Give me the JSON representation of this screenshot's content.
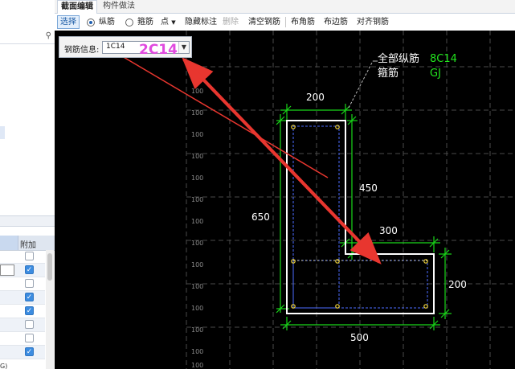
{
  "tabs": {
    "section_edit": "截面编辑",
    "member_method": "构件做法"
  },
  "toolbar": {
    "select": "选择",
    "longitudinal": "纵筋",
    "stirrup": "箍筋",
    "point": "点",
    "hide_annotation": "隐藏标注",
    "delete": "删除",
    "clear_rebar": "清空钢筋",
    "corner_rebar": "布角筋",
    "edge_rebar": "布边筋",
    "align_rebar": "对齐钢筋"
  },
  "rebar_info": {
    "label": "钢筋信息:",
    "value": "1C14"
  },
  "annotation": {
    "text": "2C14",
    "color": "#e04adf"
  },
  "legend": {
    "all_longitudinal_label": "全部纵筋",
    "all_longitudinal_value": "8C14",
    "stirrup_label": "箍筋",
    "stirrup_value": "GJ",
    "text_color": "#ffffff",
    "value_color": "#22e61e"
  },
  "dimensions": {
    "top_width": "200",
    "right_height": "450",
    "total_height": "650",
    "step_width": "300",
    "bottom_height": "200",
    "bottom_width": "500"
  },
  "grid_labels": [
    "100",
    "100",
    "100",
    "100",
    "100",
    "100",
    "100",
    "100",
    "100",
    "100",
    "100",
    "100",
    "100",
    "100",
    "100"
  ],
  "left_grid": {
    "header": "附加",
    "rows": [
      false,
      true,
      false,
      true,
      true,
      false,
      false,
      true
    ],
    "footer": "G)"
  },
  "colors": {
    "dimension": "#19d719",
    "section_outline": "#ffffff",
    "arrow": "#e8362f",
    "rebar_point": "#f1d53c",
    "stirrup_line": "#4d6bff"
  }
}
